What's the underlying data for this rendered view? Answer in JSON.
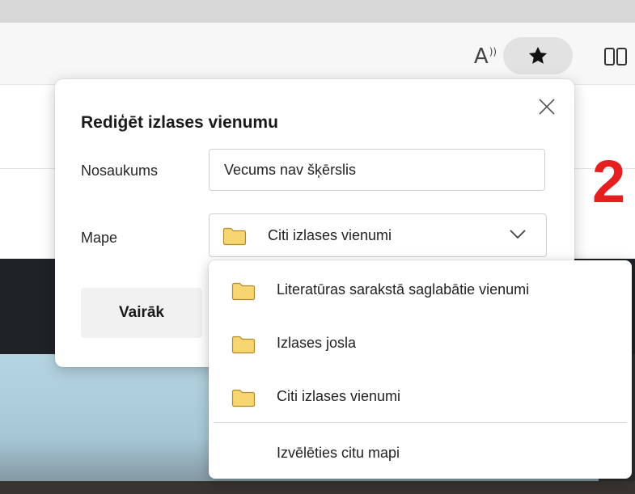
{
  "browser": {
    "read_aloud_icon": "read-aloud-icon",
    "favorite_icon": "star-icon",
    "split_icon": "split-screen-icon"
  },
  "page": {
    "step_number": "2",
    "step_color": "#e41f1f"
  },
  "dialog": {
    "title": "Rediģēt izlases vienumu",
    "name_label": "Nosaukums",
    "name_value": "Vecums nav šķērslis",
    "folder_label": "Mape",
    "folder_selected": "Citi izlases vienumi",
    "more_button": "Vairāk",
    "close_icon": "close-icon"
  },
  "folder_menu": {
    "items": [
      {
        "label": "Literatūras sarakstā saglabātie vienumi",
        "icon": "folder-icon"
      },
      {
        "label": "Izlases josla",
        "icon": "folder-icon"
      },
      {
        "label": "Citi izlases vienumi",
        "icon": "folder-icon"
      }
    ],
    "choose_other": "Izvēlēties citu mapi"
  },
  "colors": {
    "folder_fill": "#f7d571",
    "folder_stroke": "#b08a2c"
  }
}
